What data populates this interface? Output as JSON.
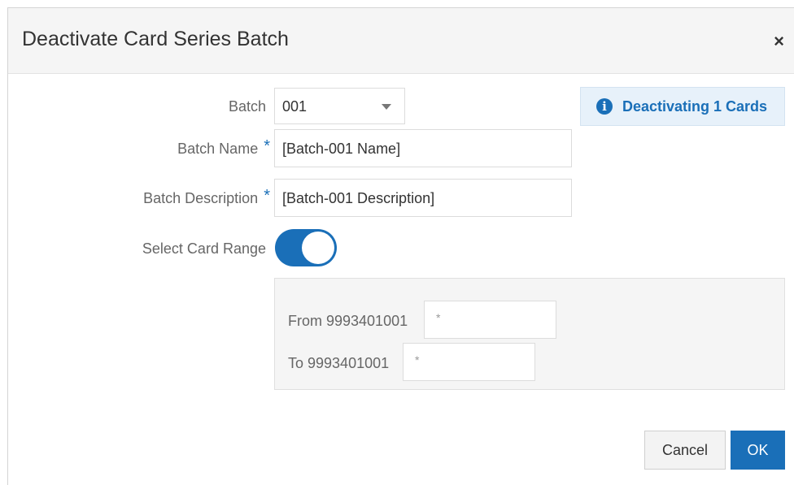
{
  "dialog": {
    "title": "Deactivate Card Series Batch",
    "close_glyph": "×"
  },
  "form": {
    "batch_label": "Batch",
    "batch_value": "001",
    "batch_name_label": "Batch Name",
    "batch_name_value": "[Batch-001 Name]",
    "batch_description_label": "Batch Description",
    "batch_description_value": "[Batch-001 Description]",
    "required_marker": "*",
    "select_card_range_label": "Select Card Range",
    "select_card_range_on": true
  },
  "info": {
    "icon": "info-circle-icon",
    "icon_glyph": "i",
    "text": "Deactivating 1 Cards"
  },
  "range": {
    "from_label": "From 9993401001",
    "from_placeholder": "*",
    "to_label": "To 9993401001",
    "to_placeholder": "*"
  },
  "footer": {
    "cancel_label": "Cancel",
    "ok_label": "OK"
  },
  "colors": {
    "accent": "#1a6fb8",
    "header_bg": "#f5f5f5",
    "info_bg": "#e7f1fa"
  }
}
